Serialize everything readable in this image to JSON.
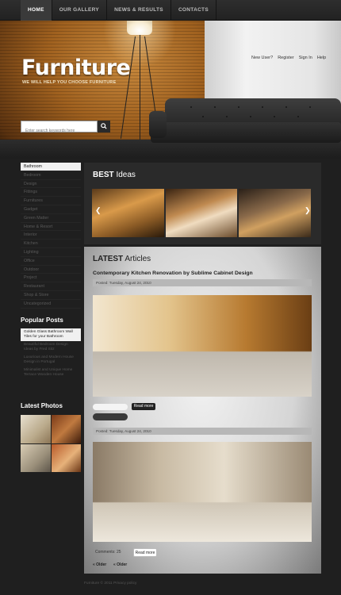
{
  "nav": {
    "items": [
      "HOME",
      "OUR GALLERY",
      "NEWS & RESULTS",
      "CONTACTS"
    ],
    "active": "HOME"
  },
  "header": {
    "logo": "Furniture",
    "tagline": "WE WILL HELP YOU CHOOSE FURNITURE",
    "user_links": [
      "New User?",
      "Register",
      "Sign In",
      "Help"
    ],
    "search_placeholder": "Enter search keywords here"
  },
  "sidebar": {
    "categories": [
      "Bathroom",
      "Bedroom",
      "Design",
      "Fittings",
      "Furnitures",
      "Gadget",
      "Green Matter",
      "Home & Resort",
      "Interior",
      "Kitchen",
      "Lighting",
      "Office",
      "Outdoor",
      "Project",
      "Restaurant",
      "Shop & Store",
      "Uncategorized"
    ],
    "active_category": "Bathroom",
    "popular_title": "Popular Posts",
    "popular_posts": [
      "Golden Glass Bathroom Wall Tiles for your Bathroom",
      "Beautiful Bedroom Design Ideas by Fred Sitz",
      "Luxurious and Modern House Design in Portugal",
      "Minimalist and Unique Home Terrace Wooden House"
    ],
    "latest_photos_title": "Latest Photos"
  },
  "best_ideas": {
    "title_bold": "BEST",
    "title_rest": "Ideas"
  },
  "latest": {
    "title_bold": "LATEST",
    "title_rest": "Articles",
    "article_title": "Contemporary Kitchen Renovation by Sublime Cabinet Design",
    "posts": [
      {
        "posted": "Posted: Tuesday, August 24, 2010",
        "read_more": "Read more"
      },
      {
        "posted": "Posted: Tuesday, August 24, 2010",
        "comments": "Comments: 25",
        "read_more": "Read more"
      }
    ],
    "older": "« Older",
    "newer": "« Older"
  },
  "footer": {
    "text": "Furniture © 2011  Privacy policy"
  },
  "colors": {
    "bg": "#1f1f1f",
    "panel_dark": "#2a2a2a",
    "wood": "#a0611f"
  }
}
